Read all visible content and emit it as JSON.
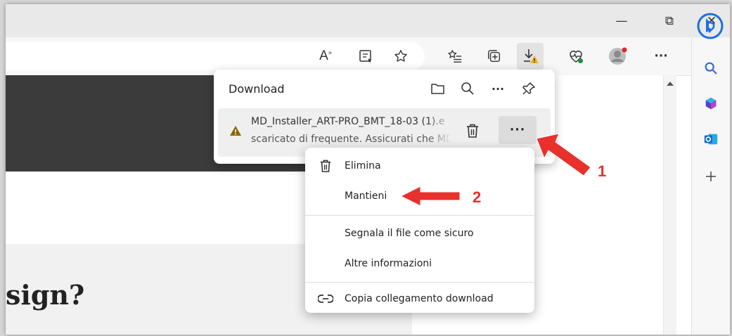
{
  "window": {
    "controls": [
      {
        "name": "minimize",
        "glyph": "—"
      },
      {
        "name": "restore",
        "glyph": "⧉"
      },
      {
        "name": "close",
        "glyph": "✕"
      }
    ]
  },
  "toolbar": {
    "read_aloud_glyph": "A",
    "more_glyph": "···",
    "download_badge_color": "#f2b01e",
    "profile_badge_color": "#e0262e"
  },
  "download_panel": {
    "title": "Download",
    "more_glyph": "···",
    "item": {
      "filename": "MD_Installer_ART-PRO_BMT_18-03 (1).e",
      "status": "scaricato di frequente. Assicurati che MD",
      "warning_color": "#8a6400",
      "more_glyph": "···"
    }
  },
  "context_menu": {
    "items": [
      {
        "id": "delete",
        "label": "Elimina"
      },
      {
        "id": "keep",
        "label": "Mantieni"
      },
      {
        "id": "report",
        "label": "Segnala il file come sicuro"
      },
      {
        "id": "info",
        "label": "Altre informazioni"
      },
      {
        "id": "copy",
        "label": "Copia collegamento download"
      }
    ]
  },
  "content": {
    "headline": "sign?"
  },
  "annotations": {
    "step1": "1",
    "step2": "2",
    "arrow_color": "#e8302c"
  }
}
